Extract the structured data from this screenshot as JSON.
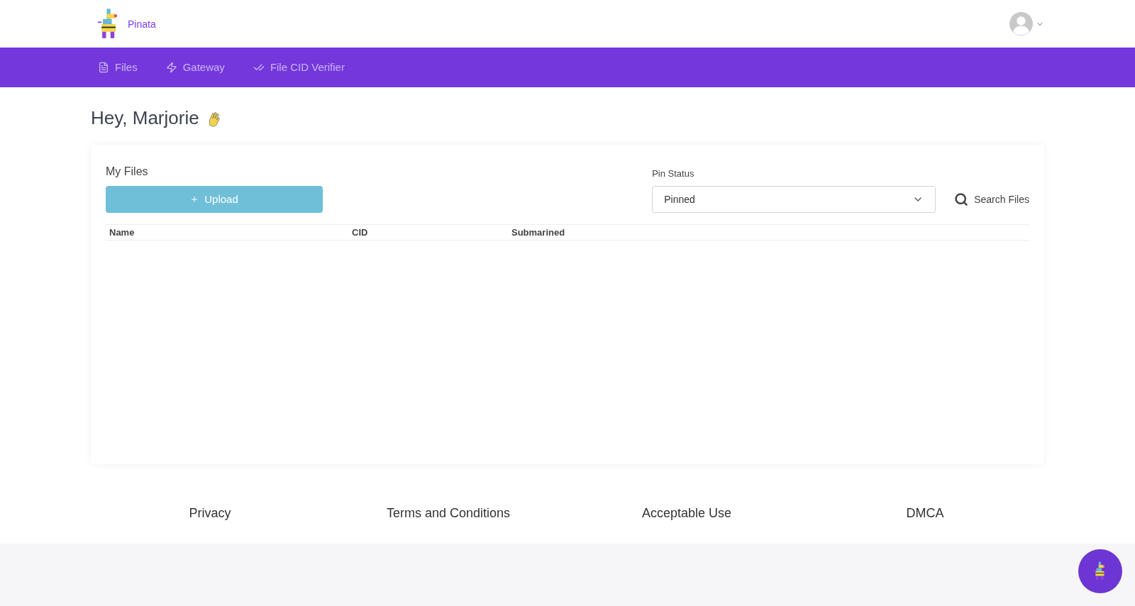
{
  "brand": {
    "name": "Pinata"
  },
  "nav": [
    {
      "label": "Files"
    },
    {
      "label": "Gateway"
    },
    {
      "label": "File CID Verifier"
    }
  ],
  "greeting": "Hey, Marjorie",
  "files": {
    "title": "My Files",
    "upload_label": "Upload",
    "pin_status": {
      "label": "Pin Status",
      "value": "Pinned"
    },
    "search_label": "Search Files",
    "columns": [
      "Name",
      "CID",
      "Submarined"
    ]
  },
  "footer": [
    "Privacy",
    "Terms and Conditions",
    "Acceptable Use",
    "DMCA"
  ]
}
